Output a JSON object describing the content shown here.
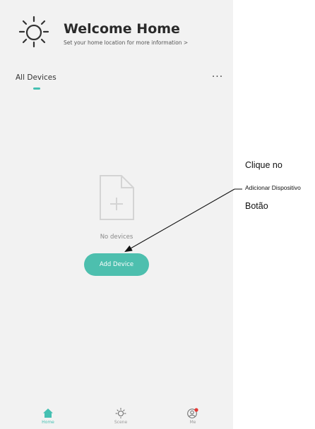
{
  "header": {
    "title": "Welcome Home",
    "subtitle": "Set your home location for more information >",
    "icon": "sun-icon"
  },
  "tabs": {
    "all_devices": "All Devices",
    "more": "···"
  },
  "empty_state": {
    "icon": "document-add-icon",
    "message": "No devices"
  },
  "add_device_button": "Add Device",
  "bottom_nav": {
    "items": [
      {
        "label": "Home",
        "icon": "home-icon",
        "active": true
      },
      {
        "label": "Scene",
        "icon": "scene-sun-icon",
        "active": false
      },
      {
        "label": "Me",
        "icon": "profile-icon",
        "active": false
      }
    ]
  },
  "annotation": {
    "line1": "Clique no",
    "line2": "Adicionar Dispositivo",
    "line3": "Botão"
  },
  "colors": {
    "accent": "#4dbfae",
    "background": "#f2f2f2",
    "notification_dot": "#e53935"
  }
}
